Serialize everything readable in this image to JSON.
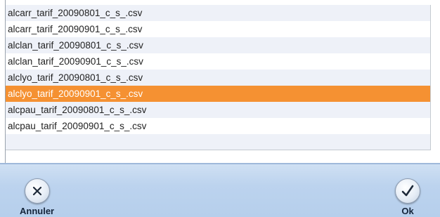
{
  "file_list": {
    "items": [
      {
        "label": "alcarr_tarif_20090801_c_s_.csv",
        "selected": false
      },
      {
        "label": "alcarr_tarif_20090901_c_s_.csv",
        "selected": false
      },
      {
        "label": "alclan_tarif_20090801_c_s_.csv",
        "selected": false
      },
      {
        "label": "alclan_tarif_20090901_c_s_.csv",
        "selected": false
      },
      {
        "label": "alclyo_tarif_20090801_c_s_.csv",
        "selected": false
      },
      {
        "label": "alclyo_tarif_20090901_c_s_.csv",
        "selected": true
      },
      {
        "label": "alcpau_tarif_20090801_c_s_.csv",
        "selected": false
      },
      {
        "label": "alcpau_tarif_20090901_c_s_.csv",
        "selected": false
      }
    ]
  },
  "toolbar": {
    "cancel_label": "Annuler",
    "ok_label": "Ok"
  },
  "colors": {
    "selection": "#f59132",
    "alt_row": "#eef1f8",
    "toolbar": "#bcd3ee"
  },
  "icons": {
    "cancel": "close-icon",
    "ok": "checkmark-icon"
  }
}
